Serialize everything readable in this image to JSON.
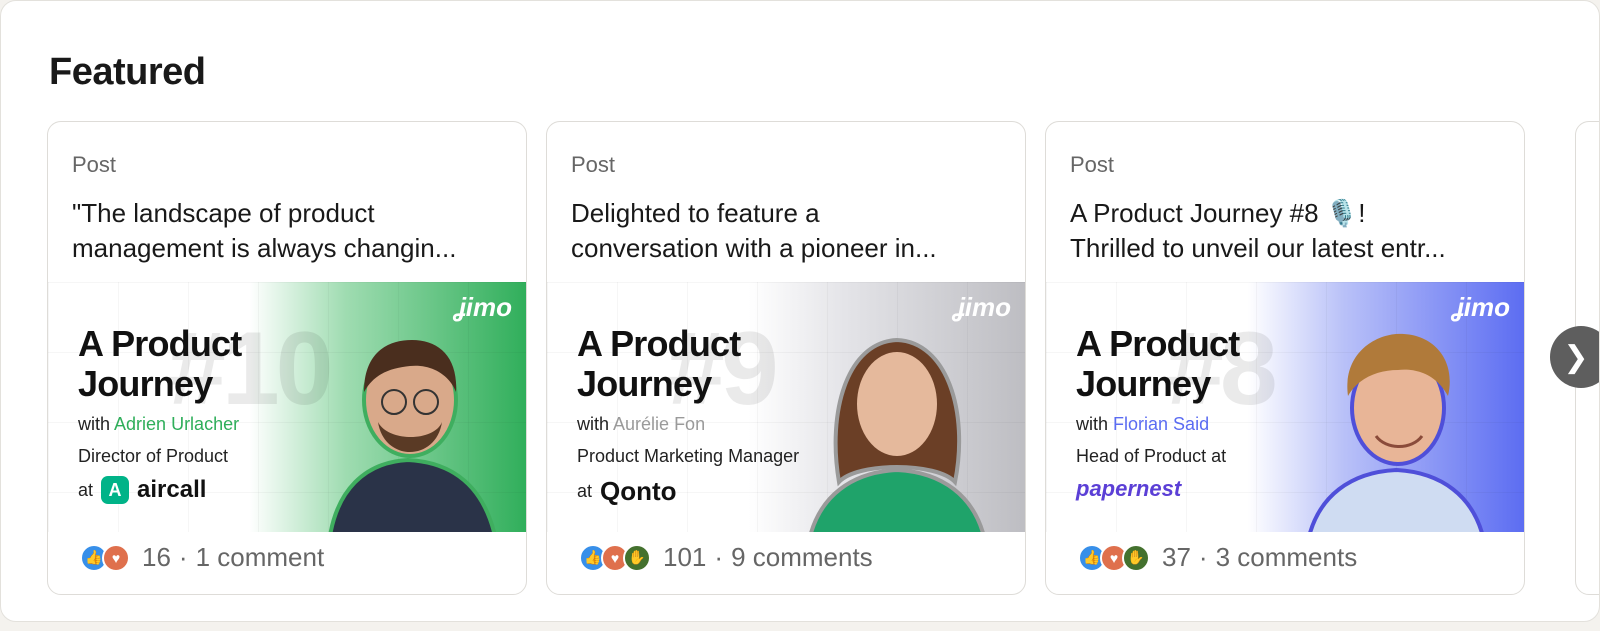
{
  "section": {
    "title": "Featured"
  },
  "cards": [
    {
      "kind": "Post",
      "text_line1": "\"The landscape of product",
      "text_line2": "management is always changin...",
      "thumb": {
        "headline1": "A Product",
        "headline2": "Journey",
        "number": "#10",
        "with_prefix": "with",
        "guest": "Adrien Urlacher",
        "role": "Director of Product",
        "at_prefix": "at",
        "company": "aircall",
        "brand": "ʝimo",
        "accent": "#2fae5a"
      },
      "reaction_count": "16",
      "separator": "·",
      "comments": "1 comment"
    },
    {
      "kind": "Post",
      "text_line1": "Delighted to feature a",
      "text_line2": "conversation with a pioneer in...",
      "thumb": {
        "headline1": "A Product",
        "headline2": "Journey",
        "number": "#9",
        "with_prefix": "with",
        "guest": "Aurélie Fon",
        "role": "Product Marketing Manager",
        "at_prefix": "at",
        "company": "Qonto",
        "brand": "ʝimo",
        "accent": "#bdbdc2"
      },
      "reaction_count": "101",
      "separator": "·",
      "comments": "9 comments"
    },
    {
      "kind": "Post",
      "text_line1": "A Product Journey #8 🎙️!",
      "text_line2": "Thrilled to unveil our latest entr...",
      "thumb": {
        "headline1": "A Product",
        "headline2": "Journey",
        "number": "#8",
        "with_prefix": "with",
        "guest": "Florian Said",
        "role": "Head of Product at",
        "at_prefix": "",
        "company": "papernest",
        "brand": "ʝimo",
        "accent": "#5b6cf2"
      },
      "reaction_count": "37",
      "separator": "·",
      "comments": "3 comments"
    }
  ],
  "next_button": {
    "glyph": "❯"
  }
}
